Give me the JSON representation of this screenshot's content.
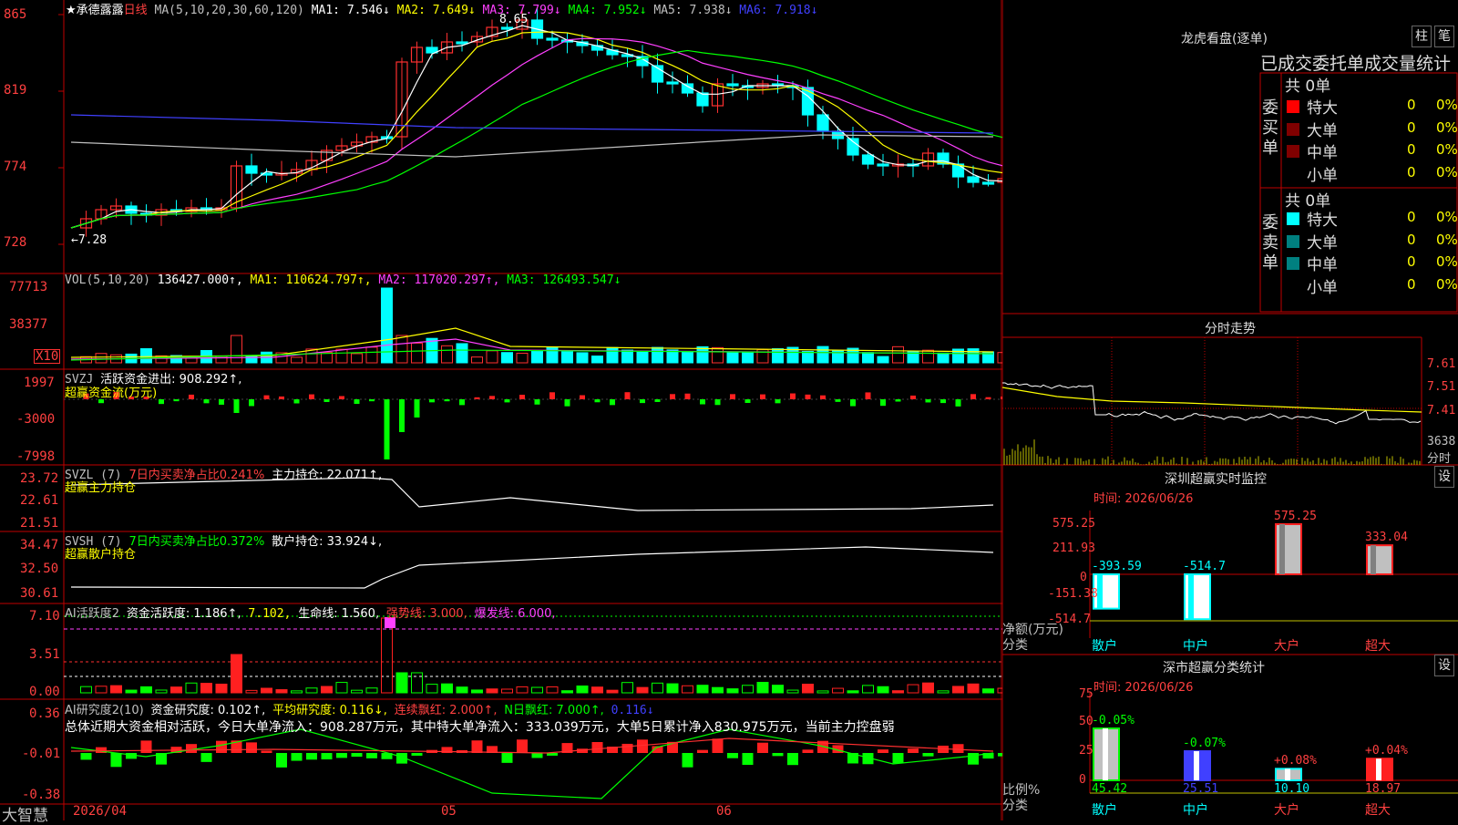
{
  "stock": {
    "name": "★承德露露",
    "period": "日线",
    "ma_header": "MA(5,10,20,30,60,120)",
    "ma": [
      {
        "label": "MA1: 7.546↓",
        "color": "#ffffff"
      },
      {
        "label": "MA2: 7.649↓",
        "color": "#ffff00"
      },
      {
        "label": "MA3: 7.799↓",
        "color": "#ff40ff"
      },
      {
        "label": "MA4: 7.952↓",
        "color": "#00ff00"
      },
      {
        "label": "MA5: 7.938↓",
        "color": "#c0c0c0"
      },
      {
        "label": "MA6: 7.918↓",
        "color": "#4040ff"
      }
    ],
    "high_mark": "8.65",
    "low_mark": "←7.28"
  },
  "price_axis": [
    "865",
    "819",
    "774",
    "728"
  ],
  "vol": {
    "header": "VOL(5,10,20)",
    "value": "136427.000↑,",
    "ma1": "MA1: 110624.797↑,",
    "ma2": "MA2: 117020.297↑,",
    "ma3": "MA3: 126493.547↓",
    "axis": [
      "77713",
      "38377"
    ],
    "unit": "X10"
  },
  "svzj": {
    "header": "SVZJ",
    "label": "活跃资金进出: 908.292↑,",
    "sub": "超赢资金流(万元)",
    "axis": [
      "1997",
      "-3000",
      "-7998"
    ]
  },
  "svzl": {
    "header": "SVZL (7)",
    "label1": "7日内买卖净占比0.241%",
    "label2": "主力持仓: 22.071↑,",
    "sub": "超赢主力持仓",
    "axis": [
      "23.72",
      "22.61",
      "21.51"
    ]
  },
  "svsh": {
    "header": "SVSH (7)",
    "label1": "7日内买卖净占比0.372%",
    "label2": "散户持仓: 33.924↓,",
    "sub": "超赢散户持仓",
    "axis": [
      "34.47",
      "32.50",
      "30.61"
    ]
  },
  "ai1": {
    "header": "AI活跃度2",
    "l1": "资金活跃度: 1.186↑,",
    "l2": "7.102,",
    "l3": "生命线: 1.560,",
    "l4": "强势线: 3.000,",
    "l5": "爆发线: 6.000,",
    "axis": [
      "7.10",
      "3.51",
      "0.00"
    ]
  },
  "ai2": {
    "header": "AI研究度2(10)",
    "l1": "资金研究度: 0.102↑,",
    "l2": "平均研究度: 0.116↓,",
    "l3": "连续飘红: 2.000↑,",
    "l4": "N日飘红: 7.000↑,",
    "l5": "0.116↓",
    "summary": "总体近期大资金相对活跃，今日大单净流入：908.287万元，其中特大单净流入：333.039万元，大单5日累计净入830.975万元，当前主力控盘弱",
    "axis": [
      "0.36",
      "-0.01",
      "-0.38"
    ]
  },
  "xaxis": {
    "start": "2026/04",
    "m05": "05",
    "m06": "06"
  },
  "brand": "大智慧",
  "right": {
    "lhb_title": "龙虎看盘(逐单)",
    "btn_zhu": "柱",
    "btn_bi": "笔",
    "stat_title": "已成交委托单成交量统计",
    "buy_label": "委买单",
    "sell_label": "委卖单",
    "buy_total": "共 0单",
    "sell_total": "共 0单",
    "rows": [
      {
        "name": "特大",
        "v": "0",
        "p": "0%"
      },
      {
        "name": "大单",
        "v": "0",
        "p": "0%"
      },
      {
        "name": "中单",
        "v": "0",
        "p": "0%"
      },
      {
        "name": "小单",
        "v": "0",
        "p": "0%"
      }
    ],
    "buy_colors": [
      "#ff0000",
      "#800000",
      "#800000",
      ""
    ],
    "sell_colors": [
      "#00ffff",
      "#008080",
      "#008080",
      ""
    ],
    "fs_title": "分时走势",
    "fs_axis": [
      "7.61",
      "7.51",
      "7.41"
    ],
    "fs_vol": "3638",
    "fs_unit": "分时",
    "sz_title": "深圳超赢实时监控",
    "sz_btn": "设",
    "sz_time": "时间: 2026/06/26",
    "sz_axis": [
      "575.25",
      "211.93",
      "0",
      "-151.38",
      "-514.7"
    ],
    "sz_unit": "净额(万元)",
    "sz_cat_label": "分类",
    "sz_bars": [
      {
        "cat": "散户",
        "label": "-393.59",
        "value": -393.59
      },
      {
        "cat": "中户",
        "label": "-514.7",
        "value": -514.7
      },
      {
        "cat": "大户",
        "label": "575.25",
        "value": 575.25
      },
      {
        "cat": "超大",
        "label": "333.04",
        "value": 333.04
      }
    ],
    "sc_title": "深市超赢分类统计",
    "sc_btn": "设",
    "sc_time": "时间: 2026/06/26",
    "sc_axis": [
      "75",
      "50",
      "25",
      "0"
    ],
    "sc_unit": "比例%",
    "sc_cat_label": "分类",
    "sc_bars": [
      {
        "cat": "散户",
        "top": "-0.05%",
        "bottom": "45.42",
        "value": 45.42
      },
      {
        "cat": "中户",
        "top": "-0.07%",
        "bottom": "25.51",
        "value": 25.51
      },
      {
        "cat": "大户",
        "top": "+0.08%",
        "bottom": "10.10",
        "value": 10.1
      },
      {
        "cat": "超大",
        "top": "+0.04%",
        "bottom": "18.97",
        "value": 18.97
      }
    ]
  },
  "colors": {
    "up": "#ff3030",
    "down": "#00ffff",
    "grid": "#c00000"
  }
}
